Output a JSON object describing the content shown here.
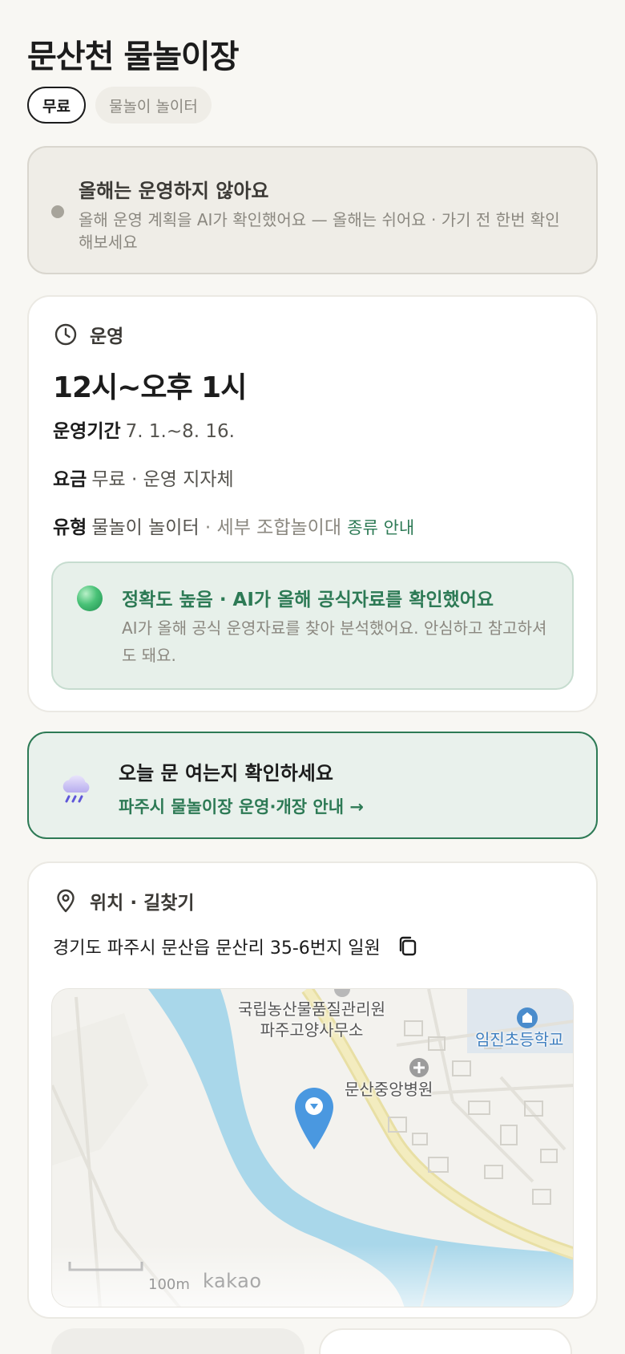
{
  "page": {
    "title": "문산천 물놀이장"
  },
  "chips": [
    {
      "label": "무료"
    },
    {
      "label": "물놀이 놀이터"
    }
  ],
  "notice": {
    "title": "올해는 운영하지 않아요",
    "desc": "올해 운영 계획을 AI가 확인했어요 — 올해는 쉬어요 · 가기 전 한번 확인해보세요"
  },
  "operation": {
    "heading": "운영",
    "hours": "12시~오후 1시",
    "period_label": "운영기간",
    "period_value": "7. 1.~8. 16.",
    "fee_label": "요금",
    "fee_value": "무료 · 운영 지자체",
    "type_label": "유형",
    "type_value": "물놀이 놀이터",
    "type_detail": "· 세부 조합놀이대",
    "type_link": "종류 안내",
    "accuracy_title": "정확도 높음 · AI가 올해 공식자료를 확인했어요",
    "accuracy_desc": "AI가 올해 공식 운영자료를 찾아 분석했어요. 안심하고 참고하셔도 돼요."
  },
  "today": {
    "title": "오늘 문 여는지 확인하세요",
    "link": "파주시 물놀이장 운영·개장 안내 →"
  },
  "location": {
    "heading": "위치 · 길찾기",
    "address": "경기도 파주시 문산읍 문산리 35-6번지 일원",
    "map": {
      "poi_1": "국립농산물품질관리원\n파주고양사무소",
      "poi_2": "문산중앙병원",
      "poi_3": "임진초등학교",
      "scale": "100m",
      "brand": "kakao"
    }
  },
  "colors": {
    "accent_green": "#2d7a55",
    "water": "#a9d7ea",
    "pin": "#4a98e0"
  }
}
